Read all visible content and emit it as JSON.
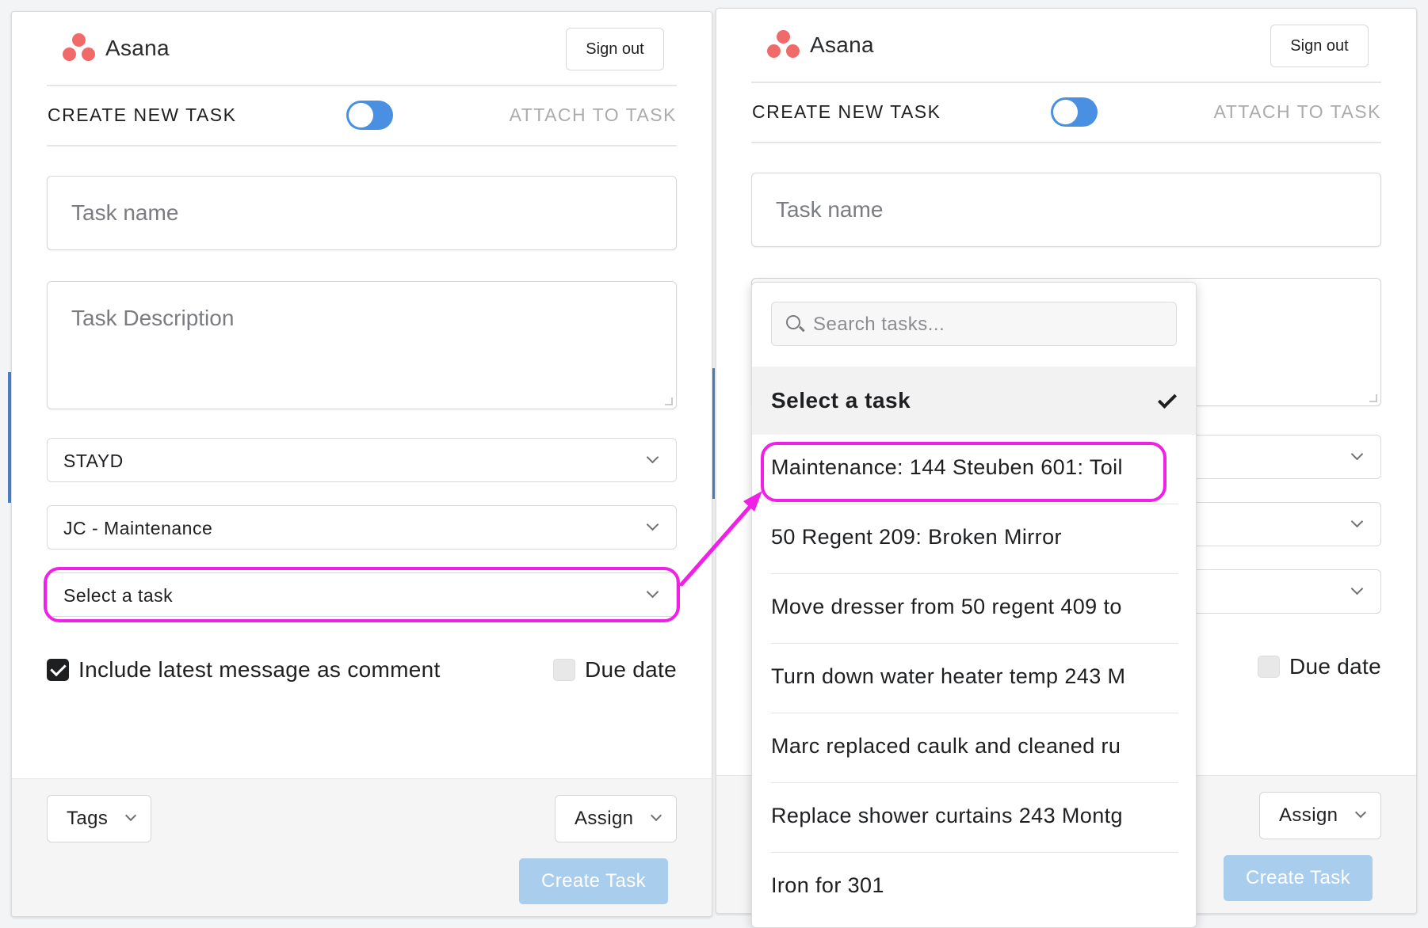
{
  "app": {
    "name": "Asana",
    "sign_out": "Sign out"
  },
  "modes": {
    "create": "CREATE NEW TASK",
    "attach": "ATTACH TO TASK"
  },
  "form": {
    "task_name_placeholder": "Task name",
    "task_description_placeholder": "Task Description",
    "workspace": "STAYD",
    "project": "JC - Maintenance",
    "task_select": "Select a task",
    "include_comment": "Include latest message as comment",
    "due_date": "Due date"
  },
  "footer": {
    "tags": "Tags",
    "assign": "Assign",
    "create": "Create Task"
  },
  "dropdown": {
    "search_placeholder": "Search tasks...",
    "selected": "Select a task",
    "options": [
      "Maintenance: 144 Steuben 601: Toil",
      "50 Regent 209: Broken Mirror",
      "Move dresser from 50 regent 409 to",
      "Turn down water heater temp 243 M",
      "Marc replaced caulk and cleaned ru",
      "Replace shower curtains 243 Montg",
      "Iron for 301"
    ]
  },
  "colors": {
    "accent": "#4a90e2",
    "brand": "#f06a6a",
    "highlight": "#f020e6",
    "create_disabled": "#a9cdec"
  }
}
